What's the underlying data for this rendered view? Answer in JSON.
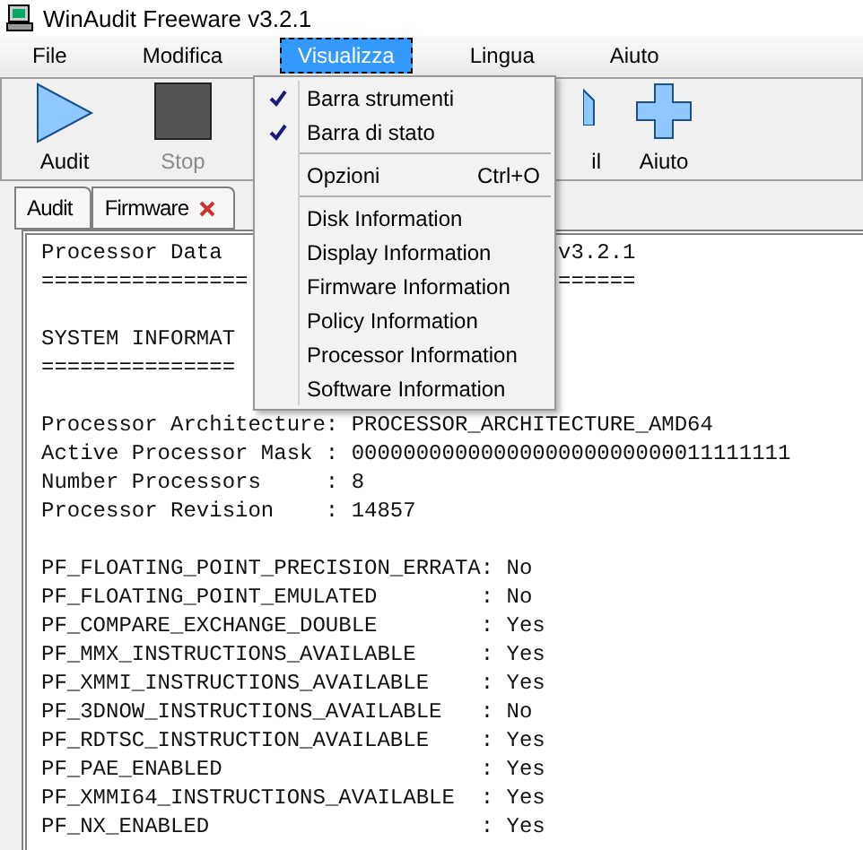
{
  "window": {
    "title": "WinAudit Freeware v3.2.1"
  },
  "menubar": [
    {
      "label": "File",
      "selected": false
    },
    {
      "label": "Modifica",
      "selected": false
    },
    {
      "label": "Visualizza",
      "selected": true
    },
    {
      "label": "Lingua",
      "selected": false
    },
    {
      "label": "Aiuto",
      "selected": false
    }
  ],
  "toolbar": [
    {
      "kind": "play",
      "label": "Audit",
      "disabled": false
    },
    {
      "kind": "stop",
      "label": "Stop",
      "disabled": true
    },
    {
      "kind": "partial",
      "label": "il",
      "disabled": false
    },
    {
      "kind": "plus",
      "label": "Aiuto",
      "disabled": false
    }
  ],
  "tabs": [
    {
      "label": "Audit",
      "selected": false,
      "closable": false
    },
    {
      "label": "Firmware",
      "selected": false,
      "closable": true
    }
  ],
  "menu": {
    "items": [
      {
        "kind": "check",
        "label": "Barra strumenti",
        "checked": true
      },
      {
        "kind": "check",
        "label": "Barra di stato",
        "checked": true
      },
      {
        "kind": "separator"
      },
      {
        "kind": "item",
        "label": "Opzioni",
        "shortcut": "Ctrl+O"
      },
      {
        "kind": "separator"
      },
      {
        "kind": "item",
        "label": "Disk Information"
      },
      {
        "kind": "item",
        "label": "Display Information"
      },
      {
        "kind": "item",
        "label": "Firmware Information"
      },
      {
        "kind": "item",
        "label": "Policy Information"
      },
      {
        "kind": "item",
        "label": "Processor Information"
      },
      {
        "kind": "item",
        "label": "Software Information"
      }
    ]
  },
  "report": {
    "lines": [
      {
        "kind": "text",
        "text": "Processor Data",
        "tail": "v3.2.1"
      },
      {
        "kind": "text",
        "text": "================",
        "tail": "======"
      },
      {
        "kind": "blank"
      },
      {
        "kind": "text",
        "text": "SYSTEM INFORMAT"
      },
      {
        "kind": "text",
        "text": "==============="
      },
      {
        "kind": "blank"
      },
      {
        "kind": "text",
        "text": "Processor Architecture: PROCESSOR_ARCHITECTURE_AMD64"
      },
      {
        "kind": "text",
        "text": "Active Processor Mask : 0000000000000000000000000011111111"
      },
      {
        "kind": "text",
        "text": "Number Processors     : 8"
      },
      {
        "kind": "text",
        "text": "Processor Revision    : 14857"
      },
      {
        "kind": "blank"
      },
      {
        "kind": "text",
        "text": "PF_FLOATING_POINT_PRECISION_ERRATA: No"
      },
      {
        "kind": "text",
        "text": "PF_FLOATING_POINT_EMULATED        : No"
      },
      {
        "kind": "text",
        "text": "PF_COMPARE_EXCHANGE_DOUBLE        : Yes"
      },
      {
        "kind": "text",
        "text": "PF_MMX_INSTRUCTIONS_AVAILABLE     : Yes"
      },
      {
        "kind": "text",
        "text": "PF_XMMI_INSTRUCTIONS_AVAILABLE    : Yes"
      },
      {
        "kind": "text",
        "text": "PF_3DNOW_INSTRUCTIONS_AVAILABLE   : No"
      },
      {
        "kind": "text",
        "text": "PF_RDTSC_INSTRUCTION_AVAILABLE    : Yes"
      },
      {
        "kind": "text",
        "text": "PF_PAE_ENABLED                    : Yes"
      },
      {
        "kind": "text",
        "text": "PF_XMMI64_INSTRUCTIONS_AVAILABLE  : Yes"
      },
      {
        "kind": "text",
        "text": "PF_NX_ENABLED                     : Yes"
      }
    ]
  }
}
